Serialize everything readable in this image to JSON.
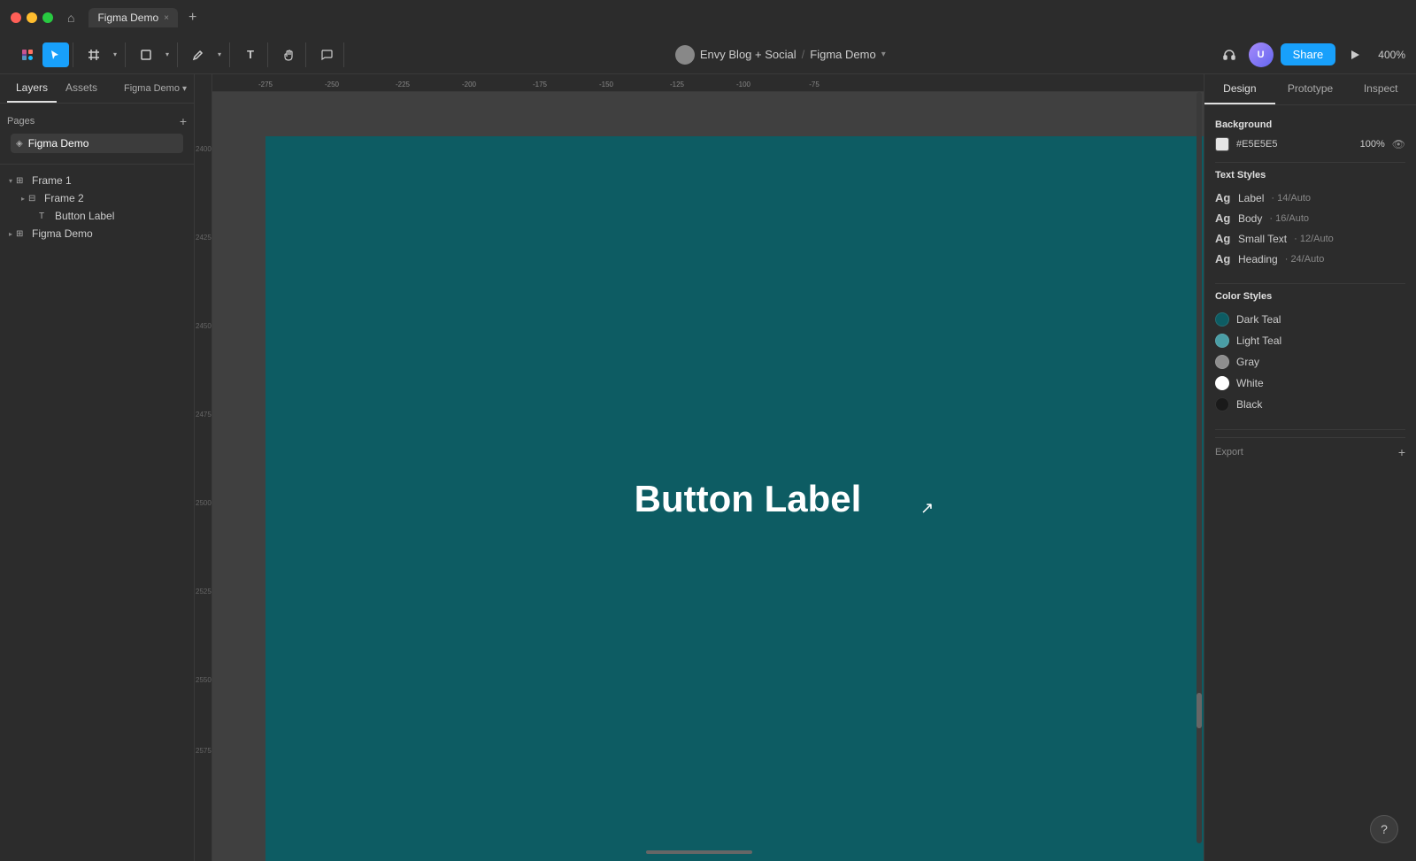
{
  "titlebar": {
    "dots": [
      "red",
      "yellow",
      "green"
    ],
    "tab_label": "Figma Demo",
    "tab_close": "×"
  },
  "toolbar": {
    "tools": [
      {
        "name": "move",
        "icon": "▸",
        "active": true
      },
      {
        "name": "frame",
        "icon": "⊞"
      },
      {
        "name": "shape",
        "icon": "□"
      },
      {
        "name": "pen",
        "icon": "✒"
      },
      {
        "name": "text",
        "icon": "T"
      },
      {
        "name": "hand",
        "icon": "✋"
      },
      {
        "name": "comment",
        "icon": "💬"
      }
    ],
    "project": "Envy Blog + Social",
    "separator": "/",
    "file_name": "Figma Demo",
    "share_label": "Share",
    "zoom_level": "400%"
  },
  "left_panel": {
    "tabs": [
      "Layers",
      "Assets"
    ],
    "breadcrumb": "Figma Demo",
    "pages_title": "Pages",
    "pages": [
      {
        "label": "Figma Demo",
        "active": true
      }
    ],
    "layers": [
      {
        "label": "Frame 1",
        "icon": "⊞",
        "level": 0,
        "expanded": true
      },
      {
        "label": "Frame 2",
        "icon": "⊟",
        "level": 1,
        "expanded": false
      },
      {
        "label": "Button Label",
        "icon": "T",
        "level": 2
      },
      {
        "label": "Figma Demo",
        "icon": "⊞",
        "level": 0
      }
    ]
  },
  "canvas": {
    "button_label": "Button Label",
    "frame_color": "#0d5c63"
  },
  "right_panel": {
    "tabs": [
      "Design",
      "Prototype",
      "Inspect"
    ],
    "active_tab": "Design",
    "background_section": "Background",
    "bg_color": "#E5E5E5",
    "bg_opacity": "100%",
    "text_styles_section": "Text Styles",
    "text_styles": [
      {
        "name": "Label",
        "size": "14/Auto"
      },
      {
        "name": "Body",
        "size": "16/Auto"
      },
      {
        "name": "Small Text",
        "size": "12/Auto"
      },
      {
        "name": "Heading",
        "size": "24/Auto"
      }
    ],
    "color_styles_section": "Color Styles",
    "color_styles": [
      {
        "name": "Dark Teal",
        "color": "#0d5c63"
      },
      {
        "name": "Light Teal",
        "color": "#4a9ea6"
      },
      {
        "name": "Gray",
        "color": "#8e8e8e"
      },
      {
        "name": "White",
        "color": "#ffffff"
      },
      {
        "name": "Black",
        "color": "#1a1a1a"
      }
    ],
    "export_label": "Export"
  },
  "help_label": "?"
}
